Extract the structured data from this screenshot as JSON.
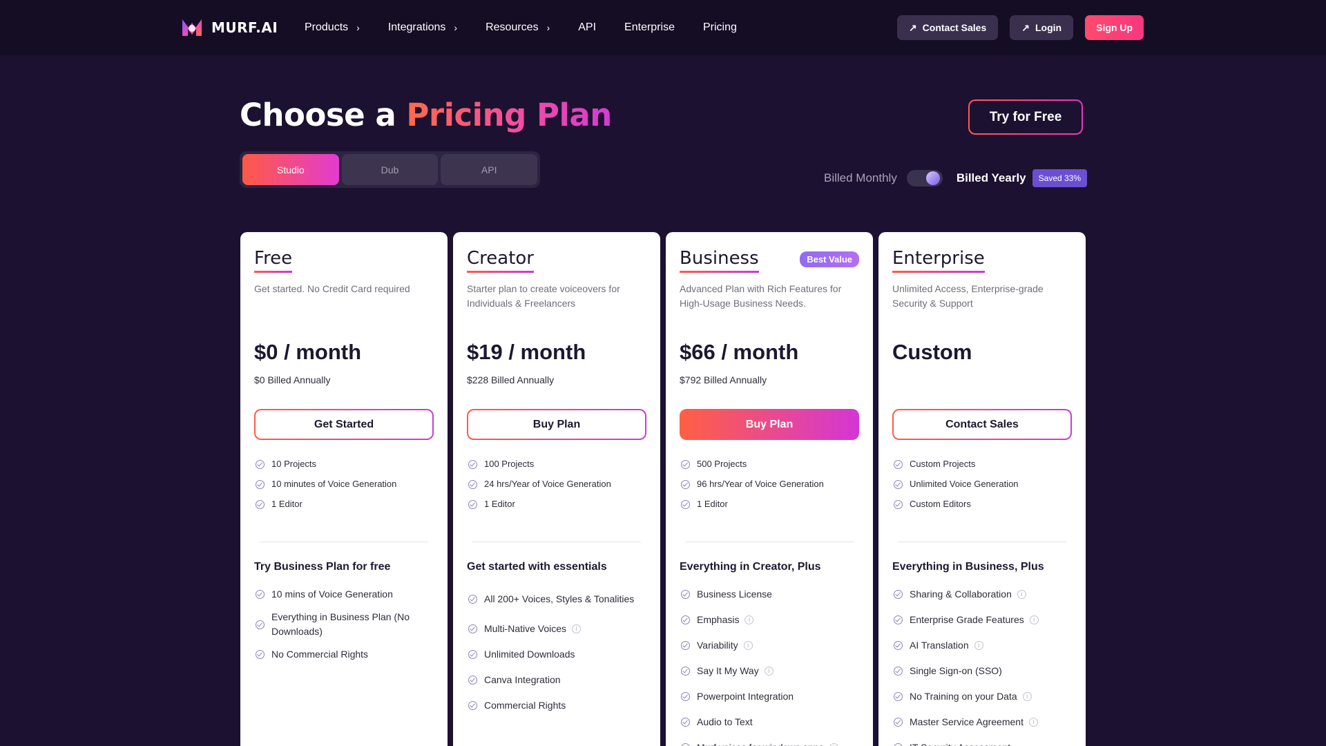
{
  "nav": {
    "logo_text": "MURF.AI",
    "items": [
      {
        "label": "Products",
        "has_chevron": true
      },
      {
        "label": "Integrations",
        "has_chevron": true
      },
      {
        "label": "Resources",
        "has_chevron": true
      },
      {
        "label": "API",
        "has_chevron": false
      },
      {
        "label": "Enterprise",
        "has_chevron": false
      },
      {
        "label": "Pricing",
        "has_chevron": false
      }
    ],
    "contact_sales": "Contact Sales",
    "login": "Login",
    "signup": "Sign Up"
  },
  "hero": {
    "title_plain": "Choose a ",
    "title_accent": "Pricing Plan",
    "try_free": "Try for Free",
    "tabs": [
      "Studio",
      "Dub",
      "API"
    ],
    "active_tab": "Studio",
    "billed_monthly": "Billed Monthly",
    "billed_yearly": "Billed Yearly",
    "saved": "Saved 33%"
  },
  "plans": [
    {
      "name": "Free",
      "badge": "",
      "desc": "Get started. No Credit Card required",
      "price": "$0 / month",
      "billed": "$0 Billed Annually",
      "cta": "Get Started",
      "cta_filled": false,
      "features": [
        "10 Projects",
        "10 minutes of Voice Generation",
        "1 Editor"
      ],
      "sub_heading": "Try Business Plan for free",
      "extras": [
        {
          "text": "10 mins of Voice Generation",
          "info": false
        },
        {
          "text": "Everything in Business Plan (No Downloads)",
          "info": false
        },
        {
          "text": "No Commercial Rights",
          "info": false
        }
      ]
    },
    {
      "name": "Creator",
      "badge": "",
      "desc": "Starter plan to create voiceovers for Individuals & Freelancers",
      "price": "$19 / month",
      "billed": "$228 Billed Annually",
      "cta": "Buy Plan",
      "cta_filled": false,
      "features": [
        "100 Projects",
        "24 hrs/Year of Voice Generation",
        "1 Editor"
      ],
      "sub_heading": "Get started with essentials",
      "extras": [
        {
          "text": "All 200+ Voices, Styles & Tonalities",
          "info": false
        },
        {
          "text": "Multi-Native Voices",
          "info": true
        },
        {
          "text": "Unlimited Downloads",
          "info": false
        },
        {
          "text": "Canva Integration",
          "info": false
        },
        {
          "text": "Commercial Rights",
          "info": false
        }
      ]
    },
    {
      "name": "Business",
      "badge": "Best Value",
      "desc": "Advanced Plan with Rich Features for High-Usage Business Needs.",
      "price": "$66 / month",
      "billed": "$792 Billed Annually",
      "cta": "Buy Plan",
      "cta_filled": true,
      "features": [
        "500 Projects",
        "96 hrs/Year of Voice Generation",
        "1 Editor"
      ],
      "sub_heading": "Everything in Creator, Plus",
      "extras": [
        {
          "text": "Business License",
          "info": false
        },
        {
          "text": "Emphasis",
          "info": true
        },
        {
          "text": "Variability",
          "info": true
        },
        {
          "text": "Say It My Way",
          "info": true
        },
        {
          "text": "Powerpoint Integration",
          "info": false
        },
        {
          "text": "Audio to Text",
          "info": false
        },
        {
          "text": "Murf voices for windows apps",
          "info": true
        }
      ]
    },
    {
      "name": "Enterprise",
      "badge": "",
      "desc": "Unlimited Access, Enterprise-grade Security & Support",
      "price": "Custom",
      "billed": "",
      "cta": "Contact Sales",
      "cta_filled": false,
      "features": [
        "Custom Projects",
        "Unlimited Voice Generation",
        "Custom Editors"
      ],
      "sub_heading": "Everything in Business, Plus",
      "extras": [
        {
          "text": "Sharing & Collaboration",
          "info": true
        },
        {
          "text": "Enterprise Grade Features",
          "info": true
        },
        {
          "text": "AI Translation",
          "info": true
        },
        {
          "text": "Single Sign-on (SSO)",
          "info": false
        },
        {
          "text": "No Training on your Data",
          "info": true
        },
        {
          "text": "Master Service Agreement",
          "info": true
        },
        {
          "text": "IT Security Assessment",
          "info": false
        }
      ]
    }
  ]
}
